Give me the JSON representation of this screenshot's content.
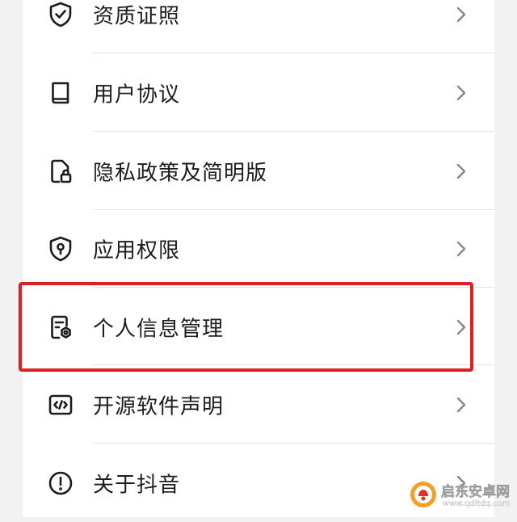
{
  "settings_list": {
    "items": [
      {
        "label": "资质证照",
        "icon": "shield-check-icon"
      },
      {
        "label": "用户协议",
        "icon": "book-icon"
      },
      {
        "label": "隐私政策及简明版",
        "icon": "document-lock-icon"
      },
      {
        "label": "应用权限",
        "icon": "shield-keyhole-icon"
      },
      {
        "label": "个人信息管理",
        "icon": "document-gear-icon"
      },
      {
        "label": "开源软件声明",
        "icon": "code-icon"
      },
      {
        "label": "关于抖音",
        "icon": "info-circle-icon"
      }
    ]
  },
  "highlighted_item": "个人信息管理",
  "colors": {
    "highlight": "#e02020",
    "text": "#1c1c1c",
    "chevron": "#888888",
    "divider": "#e3e3e3"
  },
  "watermark": {
    "name": "启东安卓网",
    "url": "www.qdltdq.com"
  }
}
